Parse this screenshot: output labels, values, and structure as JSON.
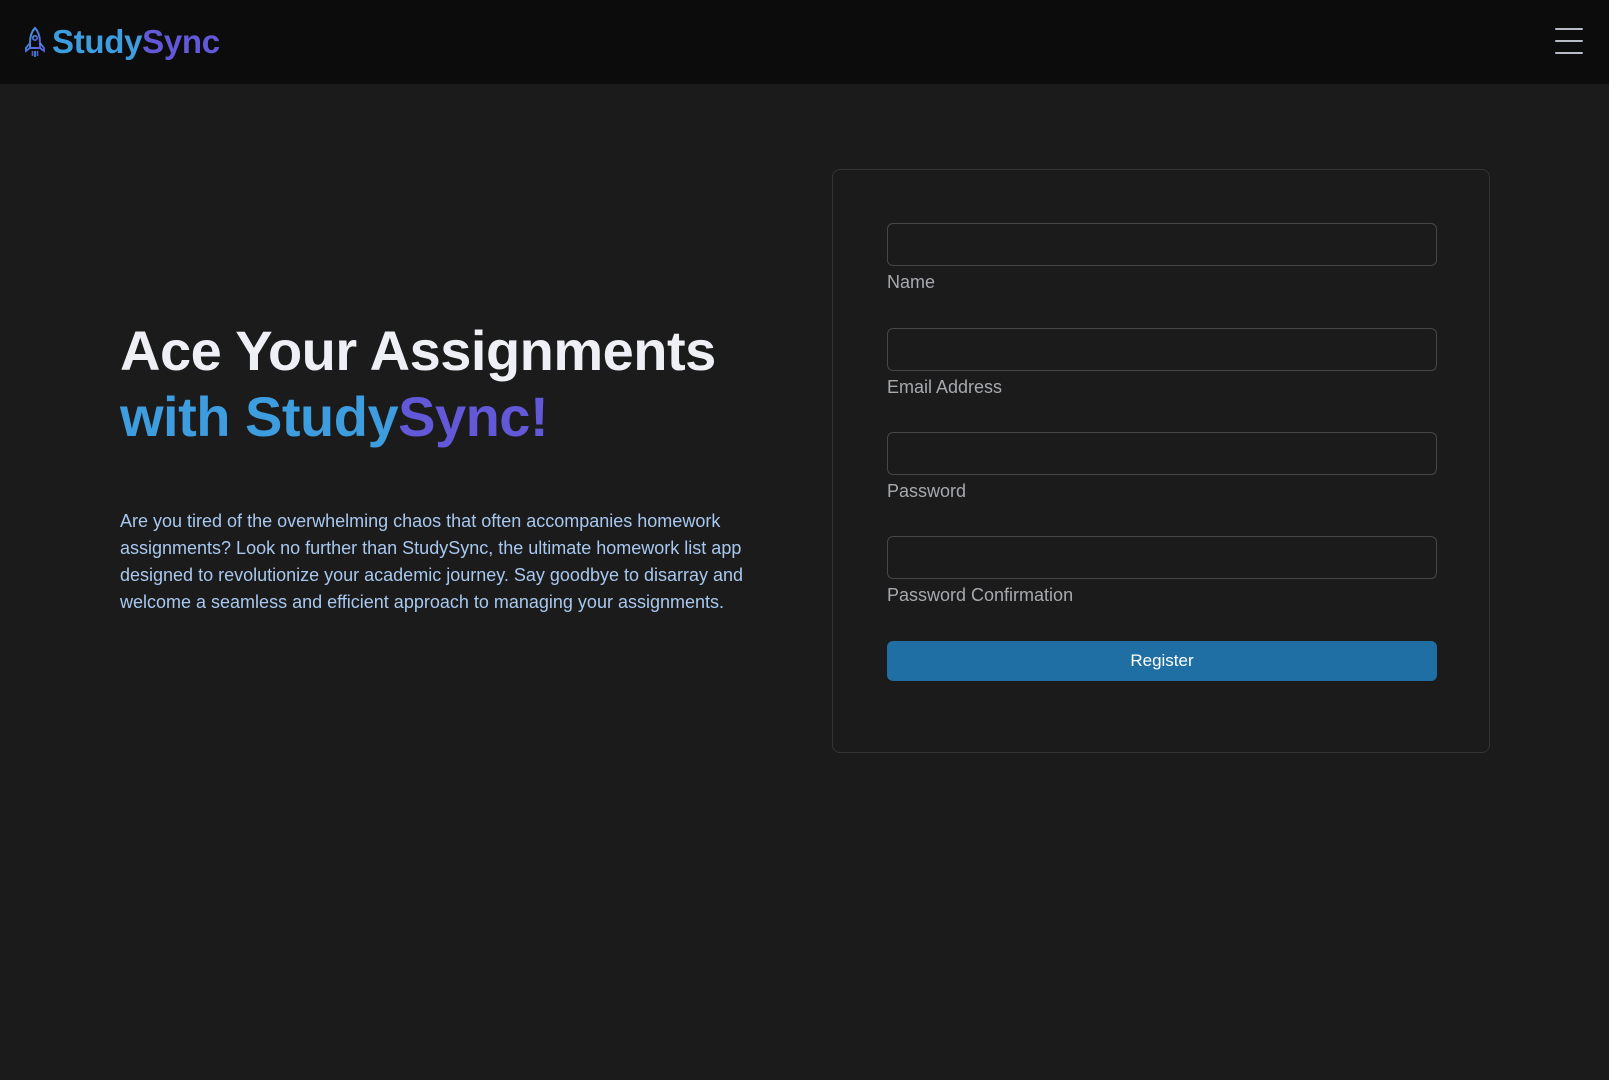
{
  "navbar": {
    "brand": {
      "part1": "Study",
      "part2": "Sync",
      "icon": "rocket-icon"
    },
    "menu_icon": "hamburger-menu-icon"
  },
  "hero": {
    "title_line1": "Ace Your Assignments",
    "title_with": "with ",
    "title_study": "Study",
    "title_sync": "Sync!",
    "description": "Are you tired of the overwhelming chaos that often accompanies homework assignments? Look no further than StudySync, the ultimate homework list app designed to revolutionize your academic journey. Say goodbye to disarray and welcome a seamless and efficient approach to managing your assignments."
  },
  "form": {
    "fields": [
      {
        "label": "Name",
        "value": ""
      },
      {
        "label": "Email Address",
        "value": ""
      },
      {
        "label": "Password",
        "value": ""
      },
      {
        "label": "Password Confirmation",
        "value": ""
      }
    ],
    "submit_label": "Register"
  },
  "colors": {
    "brand_blue": "#3d9ddf",
    "brand_purple": "#6258d8",
    "button": "#1f6fa4",
    "background": "#1b1b1b",
    "navbar": "#0c0c0c"
  }
}
